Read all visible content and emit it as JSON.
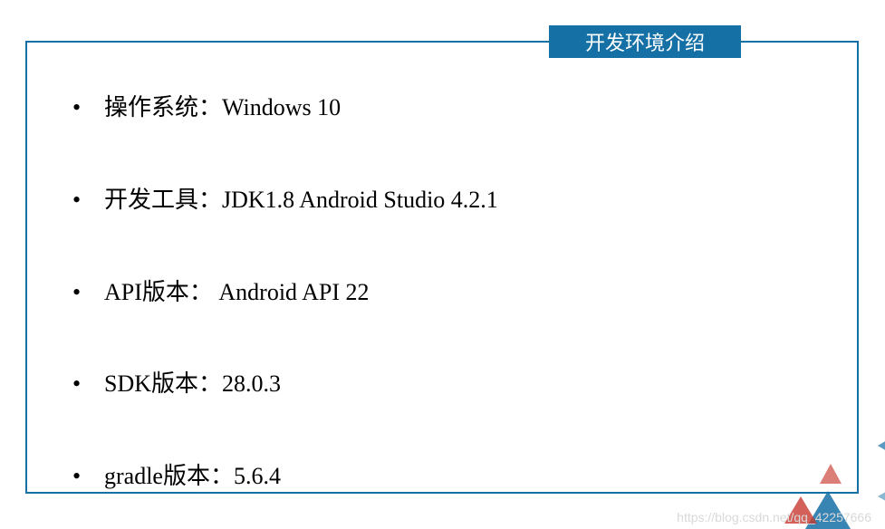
{
  "title": "开发环境介绍",
  "items": [
    "操作系统：Windows 10",
    "开发工具：JDK1.8    Android Studio 4.2.1",
    "API版本： Android API 22",
    "SDK版本：28.0.3",
    "gradle版本：5.6.4"
  ],
  "watermark": "https://blog.csdn.net/qq_42257666"
}
